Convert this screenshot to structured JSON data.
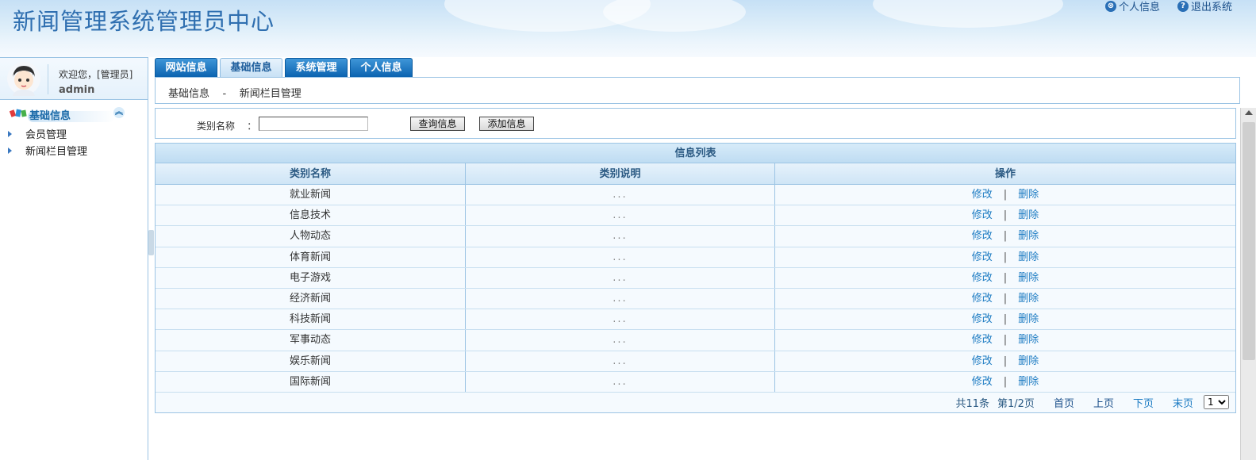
{
  "header": {
    "title": "新闻管理系统管理员中心",
    "links": [
      {
        "label": "个人信息",
        "icon": "close-circle-icon",
        "glyph": "⊗"
      },
      {
        "label": "退出系统",
        "icon": "help-circle-icon",
        "glyph": "?"
      }
    ]
  },
  "user": {
    "welcome": "欢迎您，[管理员]",
    "name": "admin"
  },
  "sidebar": {
    "section_title": "基础信息",
    "collapse_glyph": "︽",
    "items": [
      {
        "label": "会员管理"
      },
      {
        "label": "新闻栏目管理"
      }
    ]
  },
  "tabs": [
    {
      "label": "网站信息",
      "active": false
    },
    {
      "label": "基础信息",
      "active": true
    },
    {
      "label": "系统管理",
      "active": false
    },
    {
      "label": "个人信息",
      "active": false
    }
  ],
  "breadcrumb": {
    "text": "基础信息    -    新闻栏目管理"
  },
  "search": {
    "label": "类别名称    ：",
    "value": "",
    "query_button": "查询信息",
    "add_button": "添加信息"
  },
  "table": {
    "caption": "信息列表",
    "columns": [
      "类别名称",
      "类别说明",
      "操作"
    ],
    "edit_label": "修改",
    "sep": "|",
    "delete_label": "删除",
    "rows": [
      {
        "name": "就业新闻",
        "desc": "..."
      },
      {
        "name": "信息技术",
        "desc": "..."
      },
      {
        "name": "人物动态",
        "desc": "..."
      },
      {
        "name": "体育新闻",
        "desc": "..."
      },
      {
        "name": "电子游戏",
        "desc": "..."
      },
      {
        "name": "经济新闻",
        "desc": "..."
      },
      {
        "name": "科技新闻",
        "desc": "..."
      },
      {
        "name": "军事动态",
        "desc": "..."
      },
      {
        "name": "娱乐新闻",
        "desc": "..."
      },
      {
        "name": "国际新闻",
        "desc": "..."
      }
    ]
  },
  "pager": {
    "total": "共11条",
    "page": "第1/2页",
    "first": "首页",
    "prev": "上页",
    "next": "下页",
    "last": "末页",
    "selected": "1"
  },
  "colors": {
    "accent": "#0b63b0",
    "border": "#9cc4e4",
    "link": "#1a7ac2"
  }
}
